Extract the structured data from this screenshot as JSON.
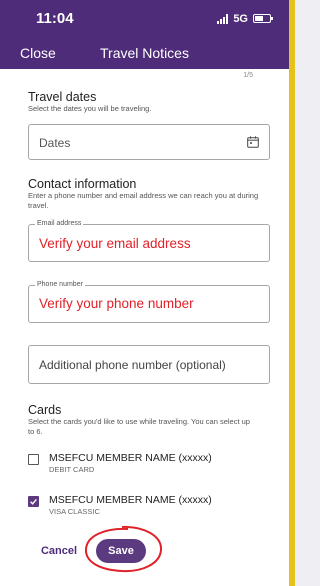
{
  "status_bar": {
    "time": "11:04",
    "network": "5G"
  },
  "nav": {
    "close_label": "Close",
    "title": "Travel Notices"
  },
  "page_indicator": "1/5",
  "travel_dates": {
    "title": "Travel dates",
    "description": "Select the dates you will be traveling.",
    "placeholder": "Dates",
    "icon": "calendar-icon"
  },
  "contact": {
    "title": "Contact information",
    "description_line1": "Enter a phone number and email address we can reach you at during",
    "description_line2": "travel.",
    "email_label": "Email address",
    "email_value": "Verify your email address",
    "phone_label": "Phone number",
    "phone_value": "Verify your phone number",
    "additional_placeholder": "Additional phone number (optional)"
  },
  "cards": {
    "title": "Cards",
    "description_line1": "Select the cards you'd like to use while traveling. You can select up",
    "description_line2": "to 6.",
    "items": [
      {
        "name": "MSEFCU MEMBER NAME (xxxxx)",
        "type": "DEBIT CARD",
        "checked": false
      },
      {
        "name": "MSEFCU MEMBER NAME (xxxxx)",
        "type": "VISA CLASSIC",
        "checked": true
      }
    ]
  },
  "actions": {
    "cancel_label": "Cancel",
    "save_label": "Save"
  },
  "colors": {
    "brand": "#4f2c7a",
    "annotation": "#e0222a",
    "side_accent": "#e6c21c"
  }
}
